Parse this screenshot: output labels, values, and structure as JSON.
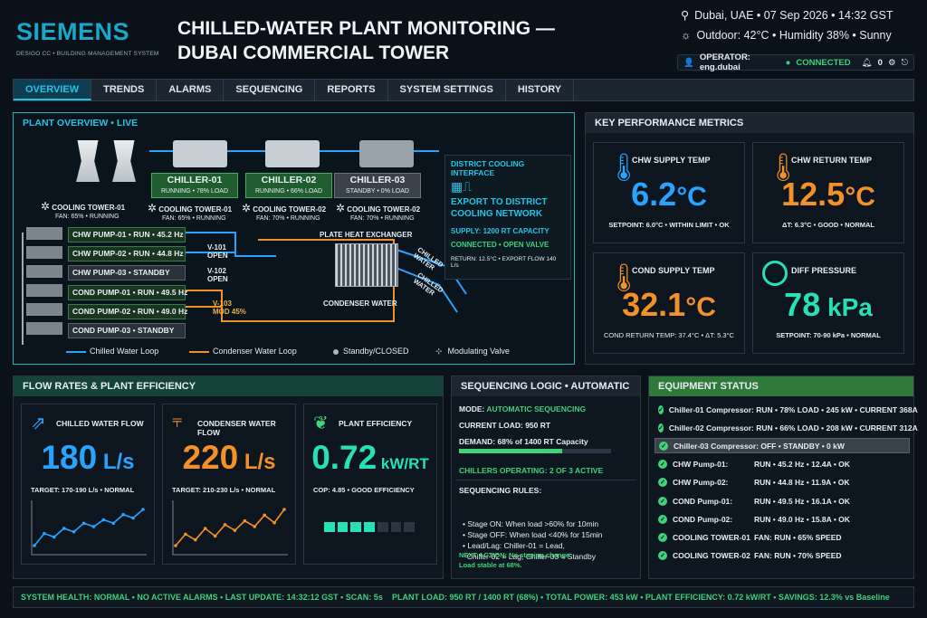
{
  "header": {
    "brand": "SIEMENS",
    "subtitle": "DESIGO CC • BUILDING MANAGEMENT SYSTEM",
    "title_line1": "CHILLED-WATER PLANT MONITORING —",
    "title_line2": "DUBAI COMMERCIAL TOWER",
    "location_time": "Dubai, UAE • 07 Sep 2026 • 14:32 GST",
    "weather": "Outdoor: 42°C • Humidity 38% • Sunny",
    "operator": "OPERATOR: eng.dubai",
    "connection": "CONNECTED",
    "alert_count": "0"
  },
  "nav": {
    "tabs": [
      "OVERVIEW",
      "TRENDS",
      "ALARMS",
      "SEQUENCING",
      "REPORTS",
      "SYSTEM SETTINGS",
      "HISTORY"
    ]
  },
  "plant": {
    "title": "PLANT OVERVIEW • LIVE",
    "chillers": [
      {
        "name": "CHILLER-01",
        "status": "RUNNING • 78% LOAD"
      },
      {
        "name": "CHILLER-02",
        "status": "RUNNING • 66% LOAD"
      },
      {
        "name": "CHILLER-03",
        "status": "STANDBY • 0% LOAD"
      }
    ],
    "towers": [
      {
        "name": "COOLING TOWER-01",
        "status": "FAN: 65% • RUNNING"
      },
      {
        "name": "COOLING TOWER-01",
        "status": "FAN: 65% • RUNNING"
      },
      {
        "name": "COOLING TOWER-02",
        "status": "FAN: 70% • RUNNING"
      },
      {
        "name": "COOLING TOWER-02",
        "status": "FAN: 70% • RUNNING"
      }
    ],
    "pumps": [
      "CHW PUMP-01 • RUN • 45.2 Hz",
      "CHW PUMP-02 • RUN • 44.8 Hz",
      "CHW PUMP-03 • STANDBY",
      "COND PUMP-01 • RUN • 49.5 Hz",
      "COND PUMP-02 • RUN • 49.0 Hz",
      "COND PUMP-03 • STANDBY"
    ],
    "valves": [
      {
        "name": "V-101",
        "state": "OPEN"
      },
      {
        "name": "V-102",
        "state": "OPEN"
      },
      {
        "name": "V-103",
        "state": "MOD 45%"
      }
    ],
    "phe": "PLATE HEAT EXCHANGER",
    "condenser": "CONDENSER WATER",
    "chilled_label1": "CHILLED WATER",
    "chilled_label2": "CHILLED WATER",
    "district": {
      "title": "DISTRICT COOLING INTERFACE",
      "export": "EXPORT TO DISTRICT COOLING NETWORK",
      "supply": "SUPPLY: 1200 RT CAPACITY",
      "status": "CONNECTED • OPEN VALVE",
      "ret": "RETURN: 12.5°C • EXPORT FLOW 140 L/s"
    },
    "legend": [
      "Chilled Water Loop",
      "Condenser Water Loop",
      "Standby/CLOSED",
      "Modulating Valve"
    ]
  },
  "kpi": {
    "title": "KEY PERFORMANCE METRICS",
    "items": [
      {
        "title": "CHW SUPPLY TEMP",
        "value": "6.2",
        "unit": "°C",
        "footer": "SETPOINT: 6.0°C • WITHIN LIMIT • OK"
      },
      {
        "title": "CHW RETURN TEMP",
        "value": "12.5",
        "unit": "°C",
        "footer": "ΔT: 6.3°C • GOOD • NORMAL"
      },
      {
        "title": "COND SUPPLY TEMP",
        "value": "32.1",
        "unit": "°C",
        "footer": "COND RETURN TEMP: 37.4°C • ΔT: 5.3°C"
      },
      {
        "title": "DIFF PRESSURE",
        "value": "78",
        "unit": " kPa",
        "footer": "SETPOINT: 70-90 kPa • NORMAL"
      }
    ]
  },
  "flow": {
    "title": "FLOW RATES & PLANT EFFICIENCY",
    "items": [
      {
        "title": "CHILLED WATER FLOW",
        "value": "180",
        "unit": " L/s",
        "footer": "TARGET: 170-190 L/s • NORMAL"
      },
      {
        "title": "CONDENSER WATER FLOW",
        "value": "220",
        "unit": " L/s",
        "footer": "TARGET: 210-230 L/s • NORMAL"
      },
      {
        "title": "PLANT EFFICIENCY",
        "value": "0.72",
        "unit": " kW/RT",
        "footer": "COP: 4.85 • GOOD EFFICIENCY"
      }
    ],
    "efficiency_level": 0.55
  },
  "sequencing": {
    "title": "SEQUENCING LOGIC • AUTOMATIC",
    "mode_label": "MODE: ",
    "mode": "AUTOMATIC SEQUENCING",
    "load": "CURRENT LOAD: 950 RT",
    "demand": "DEMAND: 68% of 1400 RT Capacity",
    "demand_pct": 68,
    "operating": "CHILLERS OPERATING: 2 OF 3 ACTIVE",
    "rules_title": "SEQUENCING RULES:",
    "rules": [
      "• Stage ON: When load >60% for 10min",
      "• Stage OFF: When load <40% for 15min",
      "• Lead/Lag: Chiller-01 = Lead,",
      "  Chiller-02 = Lag, Chiller-03 = Standby"
    ],
    "next1": "NEXT ACTION: No staging change.",
    "next2": "Load stable at 68%."
  },
  "equipment": {
    "title": "EQUIPMENT STATUS",
    "rows": [
      {
        "label": "Chiller-01 Compressor: RUN • 78% LOAD • 245 kW • CURRENT 368A",
        "value": ""
      },
      {
        "label": "Chiller-02 Compressor: RUN • 66% LOAD • 208 kW • CURRENT 312A",
        "value": ""
      },
      {
        "label": "Chiller-03 Compressor: OFF • STANDBY • 0 kW",
        "value": ""
      },
      {
        "label": "CHW Pump-01:",
        "value": "RUN • 45.2 Hz • 12.4A • OK"
      },
      {
        "label": "CHW Pump-02:",
        "value": "RUN • 44.8 Hz • 11.9A • OK"
      },
      {
        "label": "COND Pump-01:",
        "value": "RUN • 49.5 Hz • 16.1A • OK"
      },
      {
        "label": "COND Pump-02:",
        "value": "RUN • 49.0 Hz • 15.8A • OK"
      },
      {
        "label": "COOLING TOWER-01",
        "value": "FAN: RUN • 65% SPEED"
      },
      {
        "label": "COOLING TOWER-02",
        "value": "FAN: RUN • 70% SPEED"
      }
    ]
  },
  "footer": {
    "left": "SYSTEM HEALTH: NORMAL • NO ACTIVE ALARMS • LAST UPDATE: 14:32:12 GST • SCAN: 5s",
    "right": "PLANT LOAD: 950 RT / 1400 RT (68%) • TOTAL POWER: 453 kW • PLANT EFFICIENCY: 0.72 kW/RT • SAVINGS: 12.3% vs Baseline"
  },
  "colors": {
    "chw": "#2aa3ff",
    "cond": "#f2902a",
    "accent": "#27c3e6",
    "ok": "#3fd27a",
    "eff": "#27e0b6"
  },
  "chart_data": [
    {
      "type": "line",
      "x": [
        1,
        2,
        3,
        4,
        5,
        6,
        7,
        8,
        9,
        10,
        11,
        12
      ],
      "series": [
        {
          "values": [
            171,
            178,
            176,
            181,
            179,
            184,
            182,
            186,
            184,
            189,
            187,
            192
          ]
        }
      ]
    },
    {
      "type": "line",
      "x": [
        1,
        2,
        3,
        4,
        5,
        6,
        7,
        8,
        9,
        10,
        11,
        12
      ],
      "series": [
        {
          "values": [
            210,
            216,
            213,
            219,
            215,
            221,
            218,
            223,
            220,
            226,
            222,
            229
          ]
        }
      ]
    }
  ]
}
